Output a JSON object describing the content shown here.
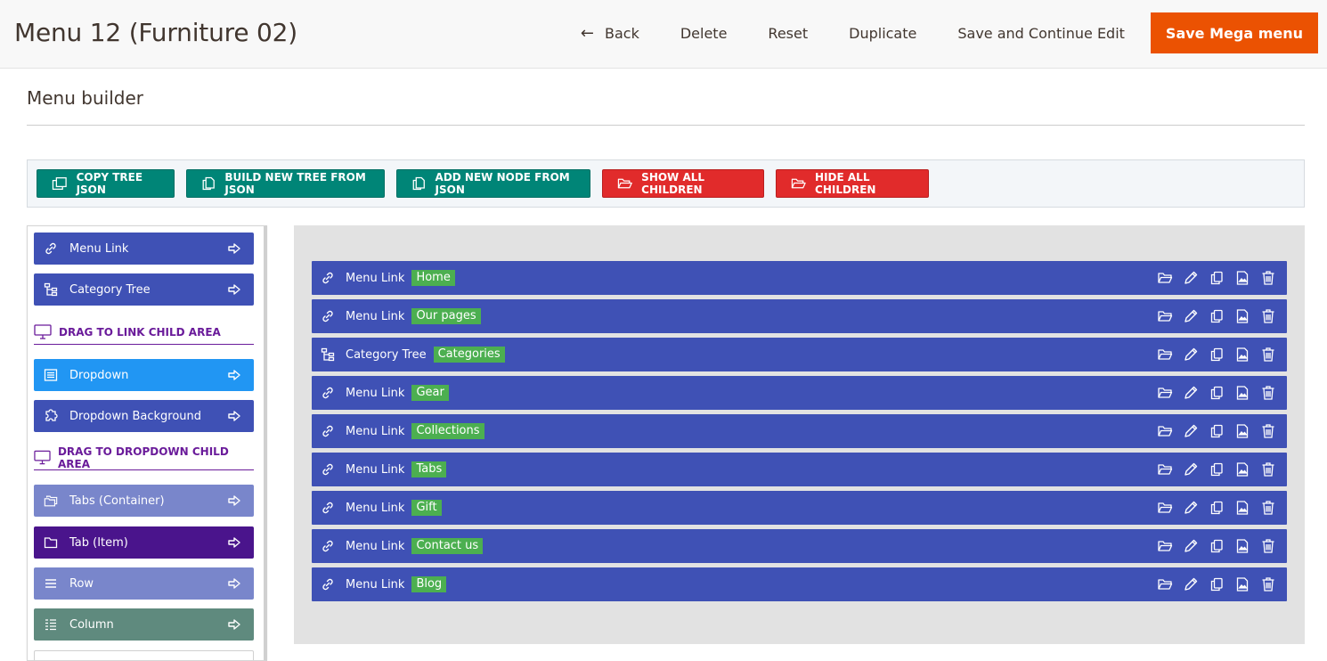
{
  "header": {
    "title": "Menu 12 (Furniture 02)",
    "back_label": "Back",
    "delete_label": "Delete",
    "reset_label": "Reset",
    "duplicate_label": "Duplicate",
    "save_continue_label": "Save and Continue Edit",
    "save_label": "Save Mega menu",
    "accent": "#eb5202"
  },
  "section": {
    "title": "Menu builder"
  },
  "toolbar": {
    "copy_tree": "COPY TREE JSON",
    "build_tree": "BUILD NEW TREE FROM JSON",
    "add_node": "ADD NEW NODE FROM JSON",
    "show_children": "SHOW ALL CHILDREN",
    "hide_children": "HIDE ALL CHILDREN"
  },
  "palette": {
    "menu_link": "Menu Link",
    "category_tree": "Category Tree",
    "drag_link_head": "DRAG TO LINK CHILD AREA",
    "dropdown": "Dropdown",
    "dropdown_bg": "Dropdown Background",
    "drag_dropdown_head": "DRAG TO DROPDOWN CHILD AREA",
    "tabs_container": "Tabs (Container)",
    "tab_item": "Tab (Item)",
    "row": "Row",
    "column": "Column"
  },
  "nodes": [
    {
      "type": "Menu Link",
      "tag": "Home",
      "icon": "link-icon"
    },
    {
      "type": "Menu Link",
      "tag": "Our pages",
      "icon": "link-icon"
    },
    {
      "type": "Category Tree",
      "tag": "Categories",
      "icon": "tree-icon"
    },
    {
      "type": "Menu Link",
      "tag": "Gear",
      "icon": "link-icon"
    },
    {
      "type": "Menu Link",
      "tag": "Collections",
      "icon": "link-icon"
    },
    {
      "type": "Menu Link",
      "tag": "Tabs",
      "icon": "link-icon"
    },
    {
      "type": "Menu Link",
      "tag": "Gift",
      "icon": "link-icon"
    },
    {
      "type": "Menu Link",
      "tag": "Contact us",
      "icon": "link-icon"
    },
    {
      "type": "Menu Link",
      "tag": "Blog",
      "icon": "link-icon"
    }
  ],
  "colors": {
    "node_blue": "#3f51b5",
    "tag_green": "#4caf50",
    "teal": "#008577",
    "red": "#e12b2b"
  }
}
